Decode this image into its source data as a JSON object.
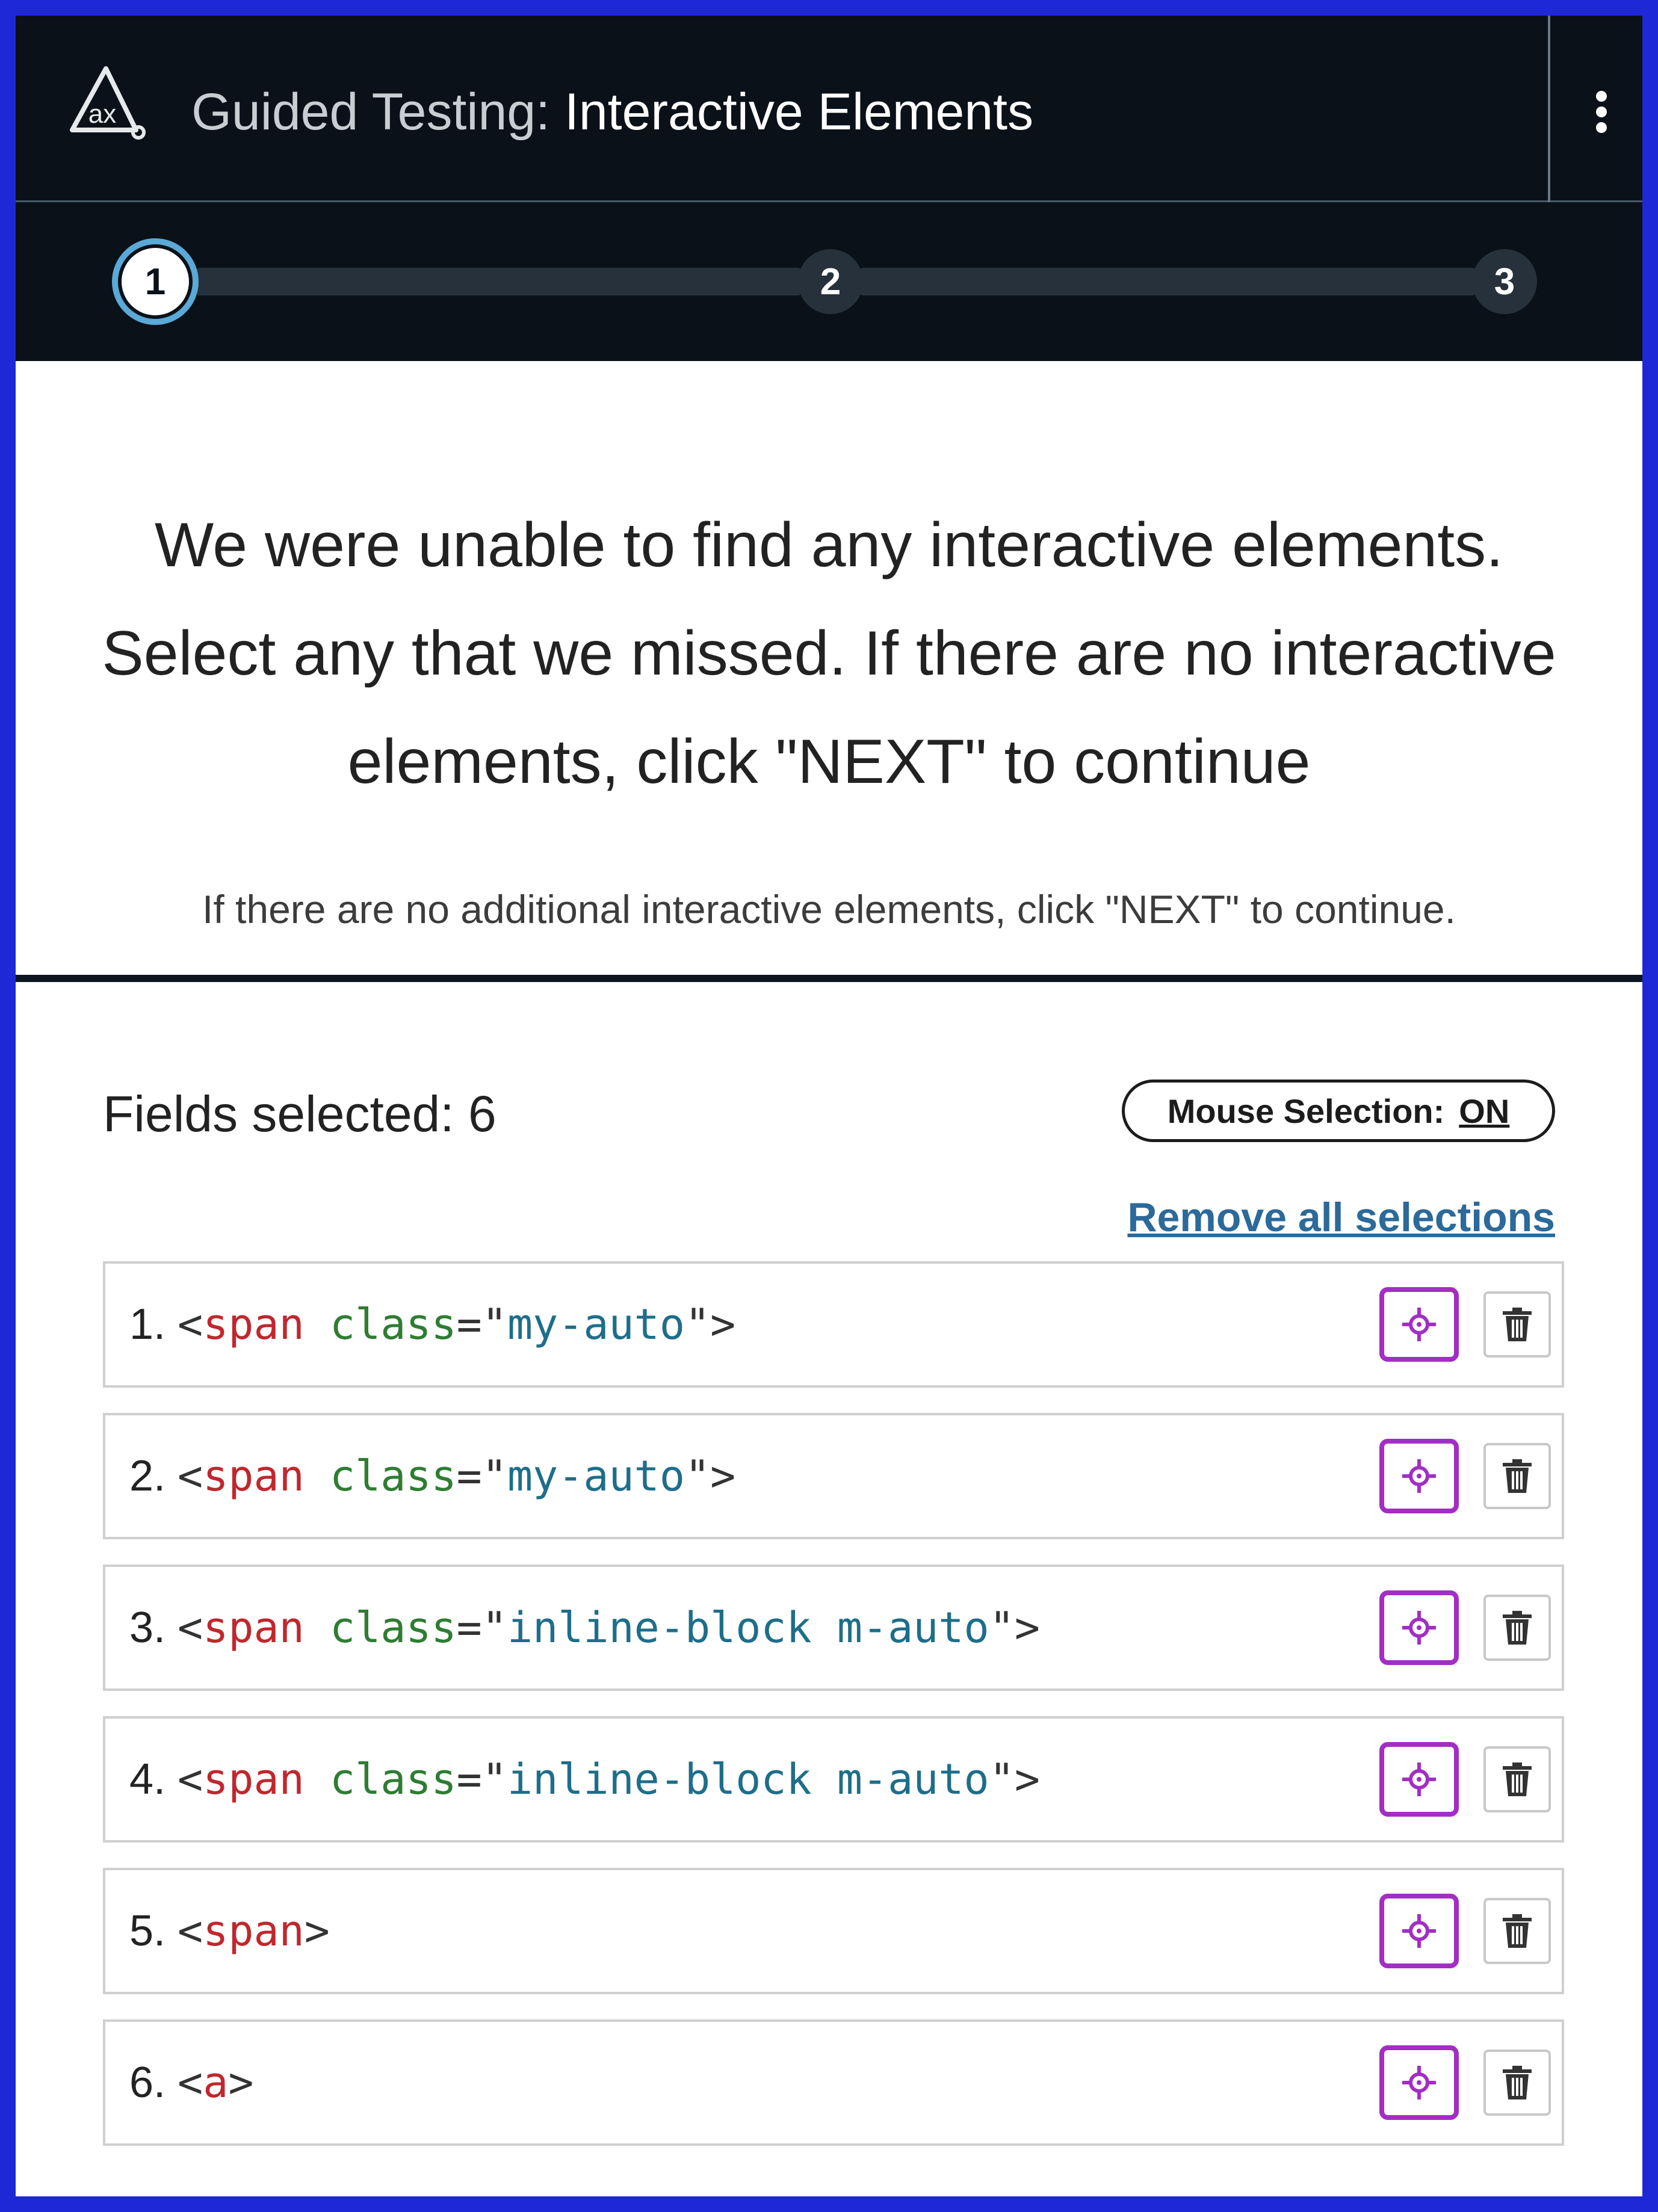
{
  "header": {
    "title_prefix": "Guided Testing:",
    "title_main": "Interactive Elements",
    "logo_text": "ax"
  },
  "stepper": {
    "steps": [
      "1",
      "2",
      "3"
    ],
    "current_step": 1
  },
  "intro": {
    "heading_lines": [
      "We were unable to find any interactive elements.",
      "Select any that we missed. If there are no interactive",
      "elements, click \"NEXT\" to continue"
    ],
    "subtext": "If there are no additional interactive elements, click \"NEXT\" to continue."
  },
  "selection": {
    "fields_selected_label": "Fields selected: 6",
    "mouse_selection_label": "Mouse Selection:",
    "mouse_selection_state": "ON",
    "remove_all_label": "Remove all selections",
    "items": [
      {
        "num": "1.",
        "open": "<",
        "tag": "span",
        "attr": "class",
        "eq": "=\"",
        "value": "my-auto",
        "close": "\">"
      },
      {
        "num": "2.",
        "open": "<",
        "tag": "span",
        "attr": "class",
        "eq": "=\"",
        "value": "my-auto",
        "close": "\">"
      },
      {
        "num": "3.",
        "open": "<",
        "tag": "span",
        "attr": "class",
        "eq": "=\"",
        "value": "inline-block m-auto",
        "close": "\">"
      },
      {
        "num": "4.",
        "open": "<",
        "tag": "span",
        "attr": "class",
        "eq": "=\"",
        "value": "inline-block m-auto",
        "close": "\">"
      },
      {
        "num": "5.",
        "open": "<",
        "tag": "span",
        "attr": "",
        "eq": "",
        "value": "",
        "close": ">"
      },
      {
        "num": "6.",
        "open": "<",
        "tag": "a",
        "attr": "",
        "eq": "",
        "value": "",
        "close": ">"
      }
    ]
  },
  "colors": {
    "header_bg": "#0a1118",
    "accent_step": "#5aa9d6",
    "highlight_border": "#a22ec4",
    "link": "#2b6a9a",
    "tag": "#c0272d",
    "attr": "#2e7d32",
    "value": "#1e6e8a"
  },
  "icons": {
    "highlight": "crosshair-icon",
    "delete": "trash-icon",
    "menu": "kebab-menu-icon",
    "logo": "axe-logo-icon"
  }
}
